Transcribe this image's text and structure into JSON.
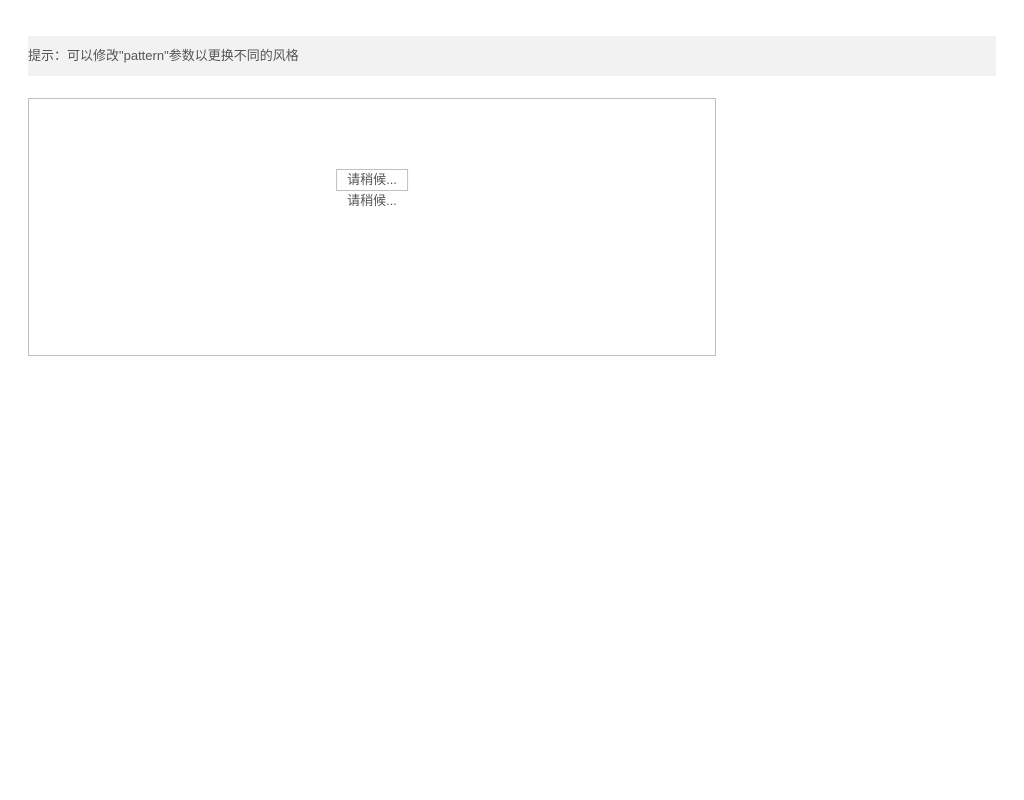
{
  "hint": {
    "text": "提示：可以修改\"pattern\"参数以更换不同的风格"
  },
  "panel": {
    "loading_1": "请稍候...",
    "loading_2": "请稍候..."
  }
}
